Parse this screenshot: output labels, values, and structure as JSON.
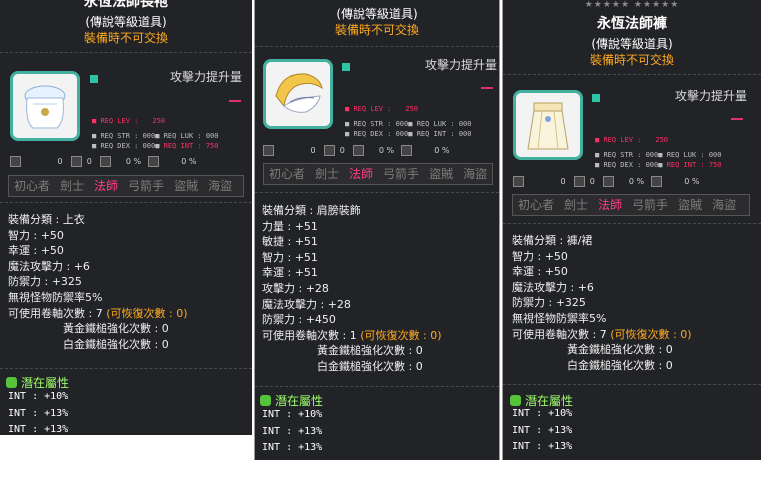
{
  "colors": {
    "panel": "#222326",
    "pink": "#ff2e64",
    "orange": "#ffaa22",
    "teal": "#43b0a0",
    "green": "#9dff6a"
  },
  "common": {
    "type_line": "(傳說等級道具)",
    "untradeable": "裝備時不可交換",
    "atk_label": "攻擊力提升量",
    "req_lev": "REQ LEV :",
    "req_str": "REQ STR :",
    "req_dex": "REQ DEX :",
    "req_luk": "REQ LUK :",
    "req_int": "REQ INT :",
    "req_zero": "000",
    "icon_vals": [
      "0",
      "0",
      "0 %",
      "0 %"
    ],
    "jobs": [
      "初心者",
      "劍士",
      "法師",
      "弓箭手",
      "盜賊",
      "海盜"
    ],
    "potential_header": "潛在屬性"
  },
  "tip1": {
    "title": "永恆法師長袍",
    "stars": "",
    "item_icon": "white-robe-icon",
    "lev": "250",
    "int_req": "750",
    "lines": [
      "裝備分類 : 上衣",
      "智力 : +50",
      "幸運 : +50",
      "魔法攻擊力 : +6",
      "防禦力 : +325",
      "無視怪物防禦率5%"
    ],
    "scroll_label": "可使用卷軸次數 : 7",
    "scroll_restore": "(可恢復次數 : 0)",
    "gold_hammer": "黃金鐵槌強化次數 : 0",
    "platinum_hammer": "白金鐵槌強化次數 : 0",
    "potentials": [
      "INT : +10%",
      "INT : +13%",
      "INT : +13%"
    ]
  },
  "tip2": {
    "title": "",
    "stars": "",
    "item_icon": "golden-shoulder-icon",
    "lev": "250",
    "int_req": "",
    "lines": [
      "裝備分類 : 肩膀裝飾",
      "力量 : +51",
      "敏捷 : +51",
      "智力 : +51",
      "幸運 : +51",
      "攻擊力 : +28",
      "魔法攻擊力 : +28",
      "防禦力 : +450"
    ],
    "scroll_label": "可使用卷軸次數 : 1",
    "scroll_restore": "(可恢復次數 : 0)",
    "gold_hammer": "黃金鐵槌強化次數 : 0",
    "platinum_hammer": "白金鐵槌強化次數 : 0",
    "potentials": [
      "INT : +10%",
      "INT : +13%",
      "INT : +13%"
    ]
  },
  "tip3": {
    "title": "永恆法師褲",
    "stars": "★★★★★ ★★★★★",
    "item_icon": "white-skirt-icon",
    "lev": "250",
    "int_req": "750",
    "lines": [
      "裝備分類 : 褲/裙",
      "智力 : +50",
      "幸運 : +50",
      "魔法攻擊力 : +6",
      "防禦力 : +325",
      "無視怪物防禦率5%"
    ],
    "scroll_label": "可使用卷軸次數 : 7",
    "scroll_restore": "(可恢復次數 : 0)",
    "gold_hammer": "黃金鐵槌強化次數 : 0",
    "platinum_hammer": "白金鐵槌強化次數 : 0",
    "potentials": [
      "INT : +10%",
      "INT : +13%",
      "INT : +13%"
    ]
  }
}
